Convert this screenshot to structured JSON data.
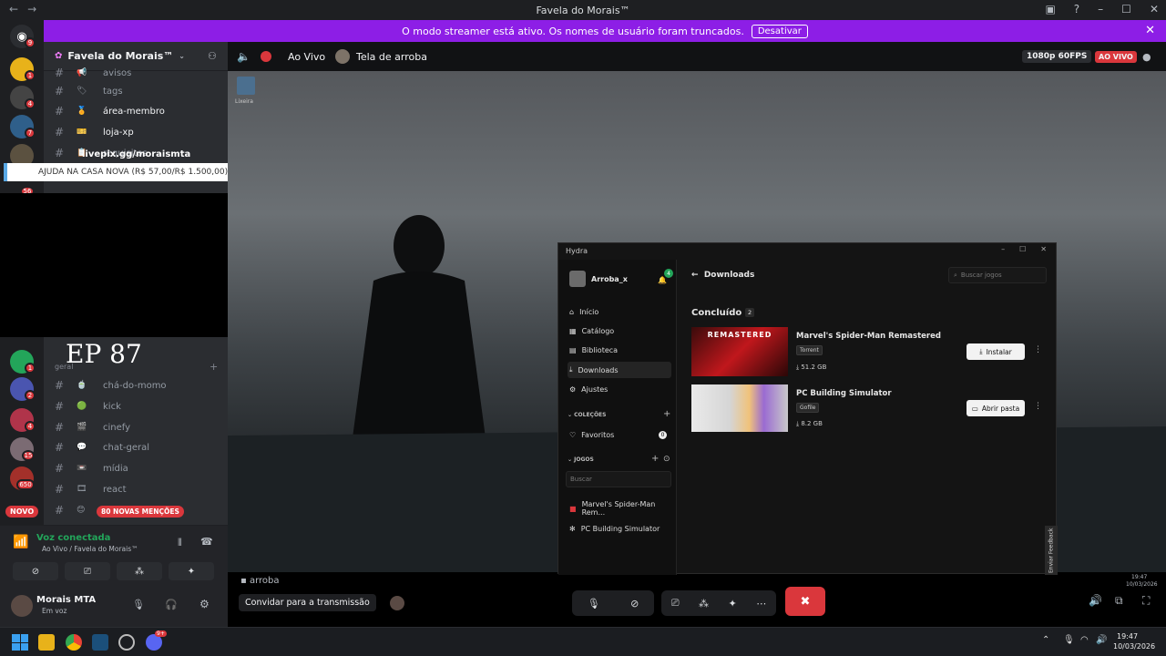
{
  "titlebar": {
    "title": "Favela do Morais™",
    "back": "←",
    "forward": "→"
  },
  "banner": {
    "text": "O modo streamer está ativo. Os nomes de usuário foram truncados.",
    "button": "Desativar"
  },
  "rail": {
    "badges": [
      "9",
      "1",
      "4",
      "7",
      "56",
      "1",
      "2",
      "4",
      "15",
      "650"
    ],
    "new_label": "NOVO"
  },
  "server": {
    "name": "Favela do Morais™"
  },
  "channels": [
    {
      "name": "avisos",
      "emoji": "📢"
    },
    {
      "name": "tags",
      "emoji": "🏷"
    },
    {
      "name": "área-membro",
      "emoji": "🏅"
    },
    {
      "name": "loja-xp",
      "emoji": "🎫"
    },
    {
      "name": "requisitos",
      "emoji": "📋"
    },
    {
      "name": "chá-do-momo",
      "emoji": "🍵"
    },
    {
      "name": "kick",
      "emoji": "🟢"
    },
    {
      "name": "cinefy",
      "emoji": "🎬"
    },
    {
      "name": "chat-geral",
      "emoji": "💬"
    },
    {
      "name": "mídia",
      "emoji": "📼"
    },
    {
      "name": "react",
      "emoji": "🎞"
    }
  ],
  "category_label": "geral",
  "mentions_pill": "80 NOVAS MENÇÕES",
  "overlay": {
    "top_text": "livepix.gg/moraismta",
    "goal": "AJUDA NA CASA NOVA (R$ 57,00/R$ 1.500,00)",
    "episode": "EP 87"
  },
  "voice": {
    "status": "Voz conectada",
    "channel": "Ao Vivo / Favela do Morais™"
  },
  "user": {
    "name": "Morais MTA",
    "status": "Em voz"
  },
  "stream_header": {
    "channel": "Ao Vivo",
    "stream_title": "Tela de arroba",
    "quality": "1080p 60FPS",
    "live": "AO VIVO"
  },
  "desktop_icon_label": "Lixeira",
  "hydra": {
    "app_title": "Hydra",
    "user": "Arroba_x",
    "notif_count": "4",
    "page_title": "Downloads",
    "search_placeholder": "Buscar jogos",
    "nav": [
      "Início",
      "Catálogo",
      "Biblioteca",
      "Downloads",
      "Ajustes"
    ],
    "collections_label": "COLEÇÕES",
    "favorites": "Favoritos",
    "favorites_count": "0",
    "games_label": "JOGOS",
    "games_search": "Buscar",
    "library": [
      "Marvel's Spider-Man Rem...",
      "PC Building Simulator"
    ],
    "section": "Concluído",
    "section_count": "2",
    "downloads": [
      {
        "title": "Marvel's Spider-Man Remastered",
        "source": "Torrent",
        "size": "51.2 GB",
        "action": "Instalar",
        "art": "REMASTERED"
      },
      {
        "title": "PC Building Simulator",
        "source": "Gofile",
        "size": "8.2 GB",
        "action": "Abrir pasta"
      }
    ],
    "feedback": "Enviar Feedback"
  },
  "stream_bottom": {
    "chat_user": "arroba",
    "invite": "Convidar para a transmissão",
    "time": "19:47",
    "date": "10/03/2026"
  },
  "taskbar": {
    "time": "19:47",
    "date": "10/03/2026",
    "discord_badge": "9+"
  },
  "colors": {
    "accent": "#8d1ee6",
    "green": "#23a55a",
    "red": "#da373c",
    "end_call": "#da373c"
  }
}
